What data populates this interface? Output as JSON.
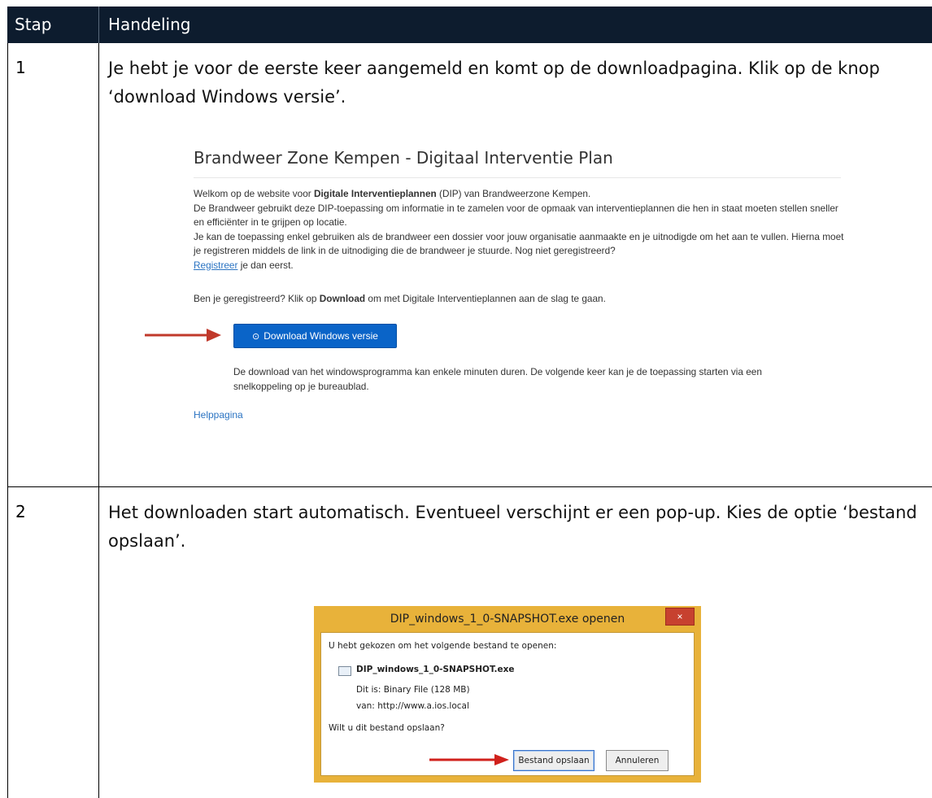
{
  "table": {
    "header": {
      "col1": "Stap",
      "col2": "Handeling"
    }
  },
  "steps": [
    {
      "number": "1",
      "text": "Je hebt je voor de eerste keer aangemeld en komt op de downloadpagina.  Klik op de knop ‘download Windows versie’."
    },
    {
      "number": "2",
      "text": "Het downloaden start automatisch. Eventueel verschijnt er een pop-up. Kies de optie ‘bestand opslaan’."
    }
  ],
  "webpage": {
    "title": "Brandweer Zone Kempen - Digitaal Interventie Plan",
    "welcome_prefix": "Welkom op de website voor ",
    "welcome_bold": "Digitale Interventieplannen",
    "welcome_suffix": " (DIP) van Brandweerzone Kempen.",
    "line2": "De Brandweer gebruikt deze DIP-toepassing om informatie in te zamelen voor de opmaak van interventieplannen die hen in staat moeten stellen sneller en efficiënter in te grijpen op locatie.",
    "line3": "Je kan de toepassing enkel gebruiken als de brandweer een dossier voor jouw organisatie aanmaakte en je uitnodigde om het aan te vullen. Hierna moet je registreren middels de link in de uitnodiging die de brandweer je stuurde. Nog niet geregistreerd?",
    "register_link": "Registreer",
    "register_suffix": " je dan eerst.",
    "ready_prefix": "Ben je geregistreerd? Klik op ",
    "ready_bold": "Download",
    "ready_suffix": " om met Digitale Interventieplannen aan de slag te gaan.",
    "download_button": "Download Windows versie",
    "download_icon": "download-icon",
    "note": "De download van het windowsprogramma kan enkele minuten duren. De volgende keer kan je de toepassing starten via een snelkoppeling op je bureaublad.",
    "help_link": "Helppagina",
    "link_color": "#2a73c2",
    "button_color": "#0a64c8"
  },
  "dialog": {
    "title": "DIP_windows_1_0-SNAPSHOT.exe openen",
    "close_label": "×",
    "intro": "U hebt gekozen om het volgende bestand te openen:",
    "file_name": "DIP_windows_1_0-SNAPSHOT.exe",
    "type_label": "Dit is:",
    "type_value": "Binary File (128 MB)",
    "from_label": "van:",
    "from_value": "http://www.a.ios.local",
    "question": "Wilt u dit bestand opslaan?",
    "save_button": "Bestand opslaan",
    "cancel_button": "Annuleren",
    "frame_color": "#e8b23a",
    "close_color": "#c7412f"
  },
  "colors": {
    "header_bg": "#0d1c2e",
    "arrow": "#c0392b"
  }
}
